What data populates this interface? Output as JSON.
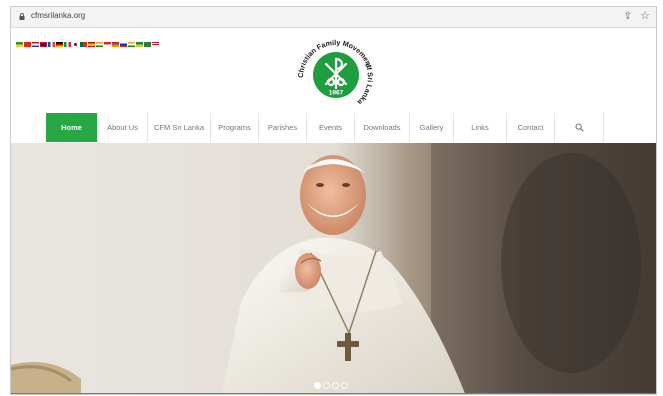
{
  "browser": {
    "url": "cfmsrilanka.org",
    "share_icon": "share-icon",
    "star_icon": "star-icon"
  },
  "language_flags": [
    "flag-1",
    "flag-2",
    "flag-3",
    "flag-4",
    "flag-5",
    "flag-6",
    "flag-7",
    "flag-8",
    "flag-9",
    "flag-10",
    "flag-11",
    "flag-12",
    "flag-13",
    "flag-14",
    "flag-15",
    "flag-16",
    "flag-17",
    "flag-18"
  ],
  "logo": {
    "ring_text_top": "Christian Family Movement",
    "ring_text_bottom": "of Sri Lanka",
    "year": "1967",
    "color": "#1e9e3e"
  },
  "nav": {
    "items": [
      {
        "label": "Home",
        "active": true
      },
      {
        "label": "About Us",
        "active": false
      },
      {
        "label": "CFM Sri Lanka",
        "active": false
      },
      {
        "label": "Programs",
        "active": false
      },
      {
        "label": "Parishes",
        "active": false
      },
      {
        "label": "Events",
        "active": false
      },
      {
        "label": "Downloads",
        "active": false
      },
      {
        "label": "Gallery",
        "active": false
      },
      {
        "label": "Links",
        "active": false
      },
      {
        "label": "Contact",
        "active": false
      }
    ],
    "search_icon": "search-icon",
    "active_color": "#28a745"
  },
  "hero": {
    "slides": 4,
    "active_slide": 1
  }
}
